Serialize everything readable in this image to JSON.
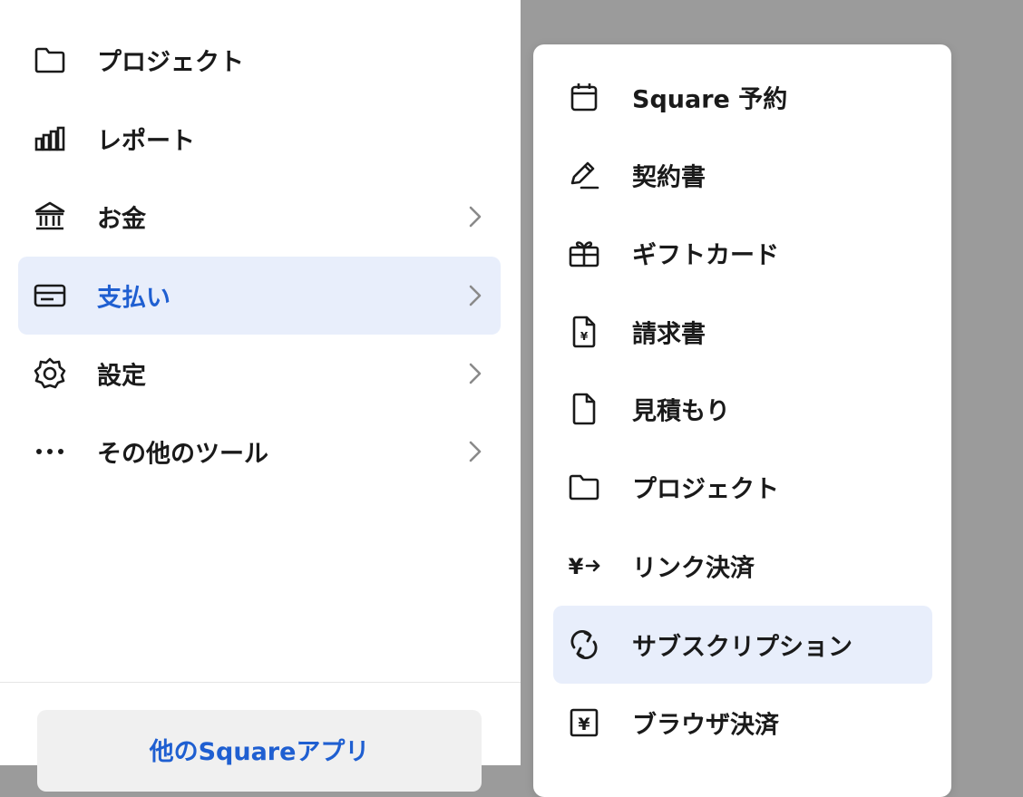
{
  "sidebar": {
    "items": [
      {
        "label": "プロジェクト",
        "icon": "folder-icon"
      },
      {
        "label": "レポート",
        "icon": "bar-chart-icon"
      },
      {
        "label": "お金",
        "icon": "bank-icon",
        "has_submenu": true
      },
      {
        "label": "支払い",
        "icon": "credit-card-icon",
        "has_submenu": true,
        "active": true
      },
      {
        "label": "設定",
        "icon": "gear-icon",
        "has_submenu": true
      },
      {
        "label": "その他のツール",
        "icon": "more-dots-icon",
        "has_submenu": true
      }
    ],
    "apps_button_label": "他のSquareアプリ"
  },
  "submenu": {
    "items": [
      {
        "label": "Square 予約",
        "icon": "calendar-icon"
      },
      {
        "label": "契約書",
        "icon": "pen-sign-icon"
      },
      {
        "label": "ギフトカード",
        "icon": "gift-icon"
      },
      {
        "label": "請求書",
        "icon": "invoice-yen-icon"
      },
      {
        "label": "見積もり",
        "icon": "document-icon"
      },
      {
        "label": "プロジェクト",
        "icon": "folder-icon"
      },
      {
        "label": "リンク決済",
        "icon": "yen-arrow-icon"
      },
      {
        "label": "サブスクリプション",
        "icon": "refresh-icon",
        "active": true
      },
      {
        "label": "ブラウザ決済",
        "icon": "yen-box-icon"
      }
    ]
  },
  "colors": {
    "accent": "#1f5fd1",
    "active_bg": "#e8eefb",
    "overlay": "#9b9b9b",
    "text": "#1a1a1a"
  }
}
